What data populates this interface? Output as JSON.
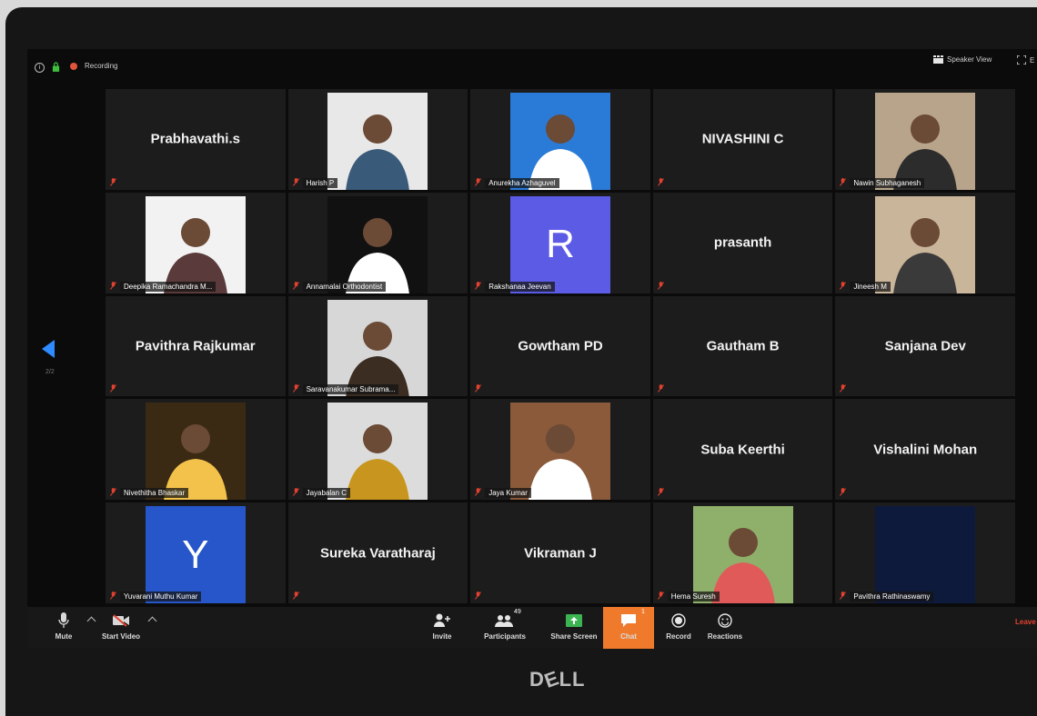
{
  "topbar": {
    "recording_label": "Recording",
    "speaker_view_label": "Speaker View",
    "gallery_label": "E"
  },
  "pager": {
    "page_indicator": "2/2"
  },
  "participants": [
    {
      "name": "Prabhavathi.s",
      "display": "name"
    },
    {
      "name": "Harish P",
      "display": "video",
      "bg": "#e8e8e8",
      "fg": "#3a5a7a"
    },
    {
      "name": "Anurekha Azhaguvel",
      "display": "video",
      "bg": "#2a7bd8",
      "fg": "#ffffff"
    },
    {
      "name": "NIVASHINI C",
      "display": "name"
    },
    {
      "name": "Nawin Subhaganesh",
      "display": "video",
      "bg": "#b7a48a",
      "fg": "#2c2c2c"
    },
    {
      "name": "Deepika Ramachandra M...",
      "display": "video",
      "bg": "#f2f2f2",
      "fg": "#5a3a3a"
    },
    {
      "name": "Annamalai Orthodontist",
      "display": "video",
      "bg": "#111111",
      "fg": "#ffffff"
    },
    {
      "name": "Rakshanaa Jeevan",
      "display": "avatar",
      "letter": "R",
      "bg": "#5b5be6"
    },
    {
      "name": "prasanth",
      "display": "name"
    },
    {
      "name": "Jineesh M",
      "display": "video",
      "bg": "#c9b59a",
      "fg": "#3a3a3a"
    },
    {
      "name": "Pavithra Rajkumar",
      "display": "name"
    },
    {
      "name": "Saravanakumar Subrama...",
      "display": "video",
      "bg": "#d7d7d7",
      "fg": "#3b2d22"
    },
    {
      "name": "Gowtham PD",
      "display": "name"
    },
    {
      "name": "Gautham B",
      "display": "name"
    },
    {
      "name": "Sanjana Dev",
      "display": "name"
    },
    {
      "name": "Nivethitha Bhaskar",
      "display": "video",
      "bg": "#3a2a14",
      "fg": "#f3c24a"
    },
    {
      "name": "Jayabalan C",
      "display": "video",
      "bg": "#dcdcdc",
      "fg": "#c8961e"
    },
    {
      "name": "Jaya Kumar",
      "display": "video",
      "bg": "#8a5a3a",
      "fg": "#ffffff"
    },
    {
      "name": "Suba Keerthi",
      "display": "name"
    },
    {
      "name": "Vishalini Mohan",
      "display": "name"
    },
    {
      "name": "Yuvarani Muthu Kumar",
      "display": "avatar",
      "letter": "Y",
      "bg": "#2656c9"
    },
    {
      "name": "Sureka Varatharaj",
      "display": "name"
    },
    {
      "name": "Vikraman J",
      "display": "name"
    },
    {
      "name": "Hema Suresh",
      "display": "video",
      "bg": "#8fb06a",
      "fg": "#e05a5a"
    },
    {
      "name": "Pavithra Rathinaswamy",
      "display": "blank",
      "bg": "#0e1a3c"
    }
  ],
  "toolbar": {
    "mute_label": "Mute",
    "start_video_label": "Start Video",
    "invite_label": "Invite",
    "participants_label": "Participants",
    "participants_count": "49",
    "share_screen_label": "Share Screen",
    "chat_label": "Chat",
    "chat_badge": "1",
    "record_label": "Record",
    "reactions_label": "Reactions",
    "leave_label": "Leave"
  },
  "laptop": {
    "brand": "DELL"
  },
  "colors": {
    "accent": "#2f8cff",
    "chat": "#f07a2c",
    "leave": "#e3412f",
    "recording": "#e0563a",
    "tile_bg": "#1c1c1c"
  }
}
